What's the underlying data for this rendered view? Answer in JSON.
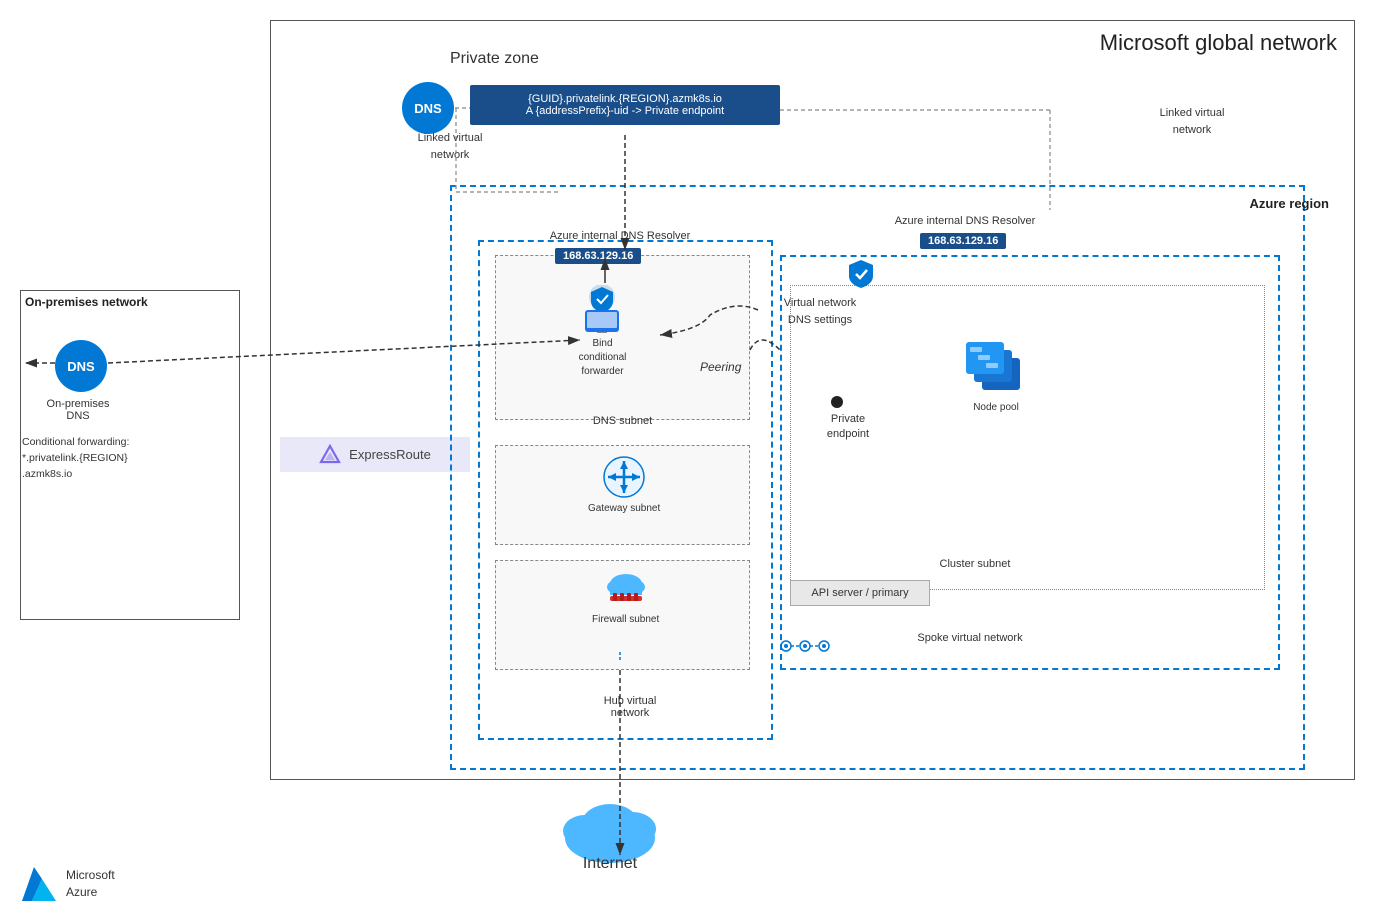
{
  "title": "Microsoft global network",
  "private_zone": {
    "label": "Private zone",
    "dns_record_line1": "{GUID}.privatelink.{REGION}.azmk8s.io",
    "dns_record_line2": "A {addressPrefix}-uid -> Private endpoint"
  },
  "on_premises": {
    "title": "On-premises network",
    "dns_label": "DNS",
    "node_label": "On-premises\nDNS",
    "conditional_forwarding": "Conditional forwarding:\n*.privatelink.{REGION}\n.azmk8s.io"
  },
  "azure_region": {
    "label": "Azure region"
  },
  "hub_vnet": {
    "label": "Hub virtual\nnetwork"
  },
  "spoke_vnet": {
    "label": "Spoke virtual network"
  },
  "dns_subnet": {
    "label": "DNS subnet",
    "ip_resolver": "168.63.129.16",
    "resolver_label": "Azure internal DNS Resolver",
    "component_label": "Bind\nconditional\nforwarder"
  },
  "gateway_subnet": {
    "label": "Gateway subnet"
  },
  "firewall_subnet": {
    "label": "Firewall subnet"
  },
  "cluster_subnet": {
    "label": "Cluster subnet",
    "private_endpoint_label": "Private\nendpoint",
    "node_pool_label": "Node pool"
  },
  "spoke_dns_resolver": {
    "ip": "168.63.129.16",
    "label": "Azure internal DNS Resolver"
  },
  "api_server": {
    "label": "API server /\nprimary"
  },
  "linked_virtual_network": "Linked virtual\nnetwork",
  "linked_virtual_network2": "Linked virtual\nnetwork",
  "vnet_dns_settings": "Virtual network\nDNS settings",
  "peering": "Peering",
  "expressroute": "ExpressRoute",
  "internet": "Internet",
  "azure_logo": "Microsoft\nAzure",
  "colors": {
    "azure_blue": "#0078d4",
    "dark_blue": "#1a4e8a",
    "dashed_border": "#0078d4",
    "dotted_border": "#888"
  }
}
